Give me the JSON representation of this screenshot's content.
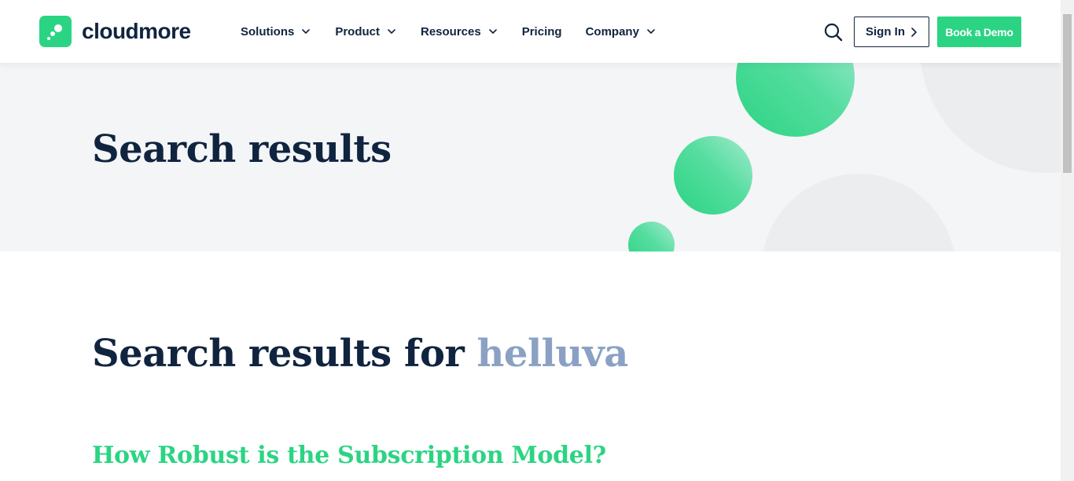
{
  "header": {
    "brand": "cloudmore",
    "nav": [
      {
        "label": "Solutions",
        "has_dropdown": true
      },
      {
        "label": "Product",
        "has_dropdown": true
      },
      {
        "label": "Resources",
        "has_dropdown": true
      },
      {
        "label": "Pricing",
        "has_dropdown": false
      },
      {
        "label": "Company",
        "has_dropdown": true
      }
    ],
    "search_icon": "search-icon",
    "signin_label": "Sign In",
    "demo_label": "Book a Demo"
  },
  "hero": {
    "title": "Search results"
  },
  "main": {
    "results_prefix": "Search results for",
    "query": "helluva",
    "first_result": "How Robust is the Subscription Model?"
  },
  "colors": {
    "brand_green": "#2bd483",
    "navy": "#10243f",
    "query_blue": "#8aa1c4",
    "hero_bg": "#f4f5f7"
  }
}
